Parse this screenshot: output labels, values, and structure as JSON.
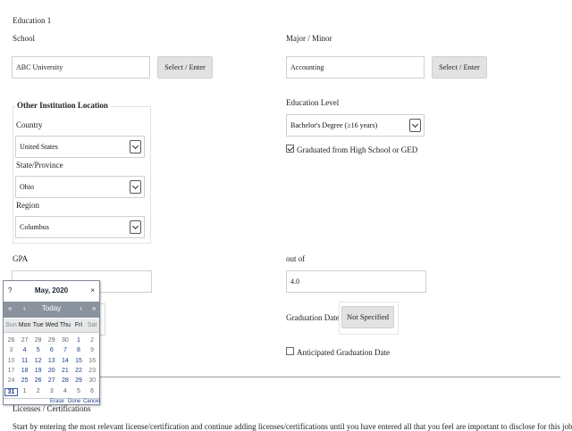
{
  "section_title": "Education 1",
  "school": {
    "label": "School",
    "value": "ABC University",
    "button": "Select / Enter"
  },
  "major": {
    "label": "Major / Minor",
    "value": "Accounting",
    "button": "Select / Enter"
  },
  "other_location": {
    "legend": "Other Institution Location",
    "country": {
      "label": "Country",
      "value": "United States"
    },
    "state": {
      "label": "State/Province",
      "value": "Ohio"
    },
    "region": {
      "label": "Region",
      "value": "Columbus"
    }
  },
  "education_level": {
    "label": "Education Level",
    "value": "Bachelor's Degree (≥16 years)"
  },
  "graduated_hs": {
    "label": "Graduated from High School or GED",
    "checked": true
  },
  "gpa": {
    "label": "GPA",
    "value": ""
  },
  "out_of": {
    "label": "out of",
    "value": "4.0"
  },
  "graduation_date": {
    "label": "Graduation Date",
    "button": "Not Specified"
  },
  "anticipated": {
    "label": "Anticipated Graduation Date",
    "checked": false
  },
  "licenses": {
    "label": "Licenses / Certifications",
    "intro": "Start by entering the most relevant license/certification and continue adding licenses/certifications until you have entered all that you feel are important to disclose for this job."
  },
  "calendar": {
    "help": "?",
    "title": "May, 2020",
    "close": "×",
    "nav": {
      "prev_year": "«",
      "prev_month": "‹",
      "today": "Today",
      "next_month": "›",
      "next_year": "»"
    },
    "weekdays": [
      "Sun",
      "Mon",
      "Tue",
      "Wed",
      "Thu",
      "Fri",
      "Sat"
    ],
    "weeks": [
      [
        "26",
        "27",
        "28",
        "29",
        "30",
        "1",
        "2"
      ],
      [
        "3",
        "4",
        "5",
        "6",
        "7",
        "8",
        "9"
      ],
      [
        "10",
        "11",
        "12",
        "13",
        "14",
        "15",
        "16"
      ],
      [
        "17",
        "18",
        "19",
        "20",
        "21",
        "22",
        "23"
      ],
      [
        "24",
        "25",
        "26",
        "27",
        "28",
        "29",
        "30"
      ],
      [
        "31",
        "1",
        "2",
        "3",
        "4",
        "5",
        "6"
      ]
    ],
    "selected_day": "31",
    "footer": {
      "erase": "Erase",
      "done": "Done",
      "cancel": "Cancel"
    }
  }
}
